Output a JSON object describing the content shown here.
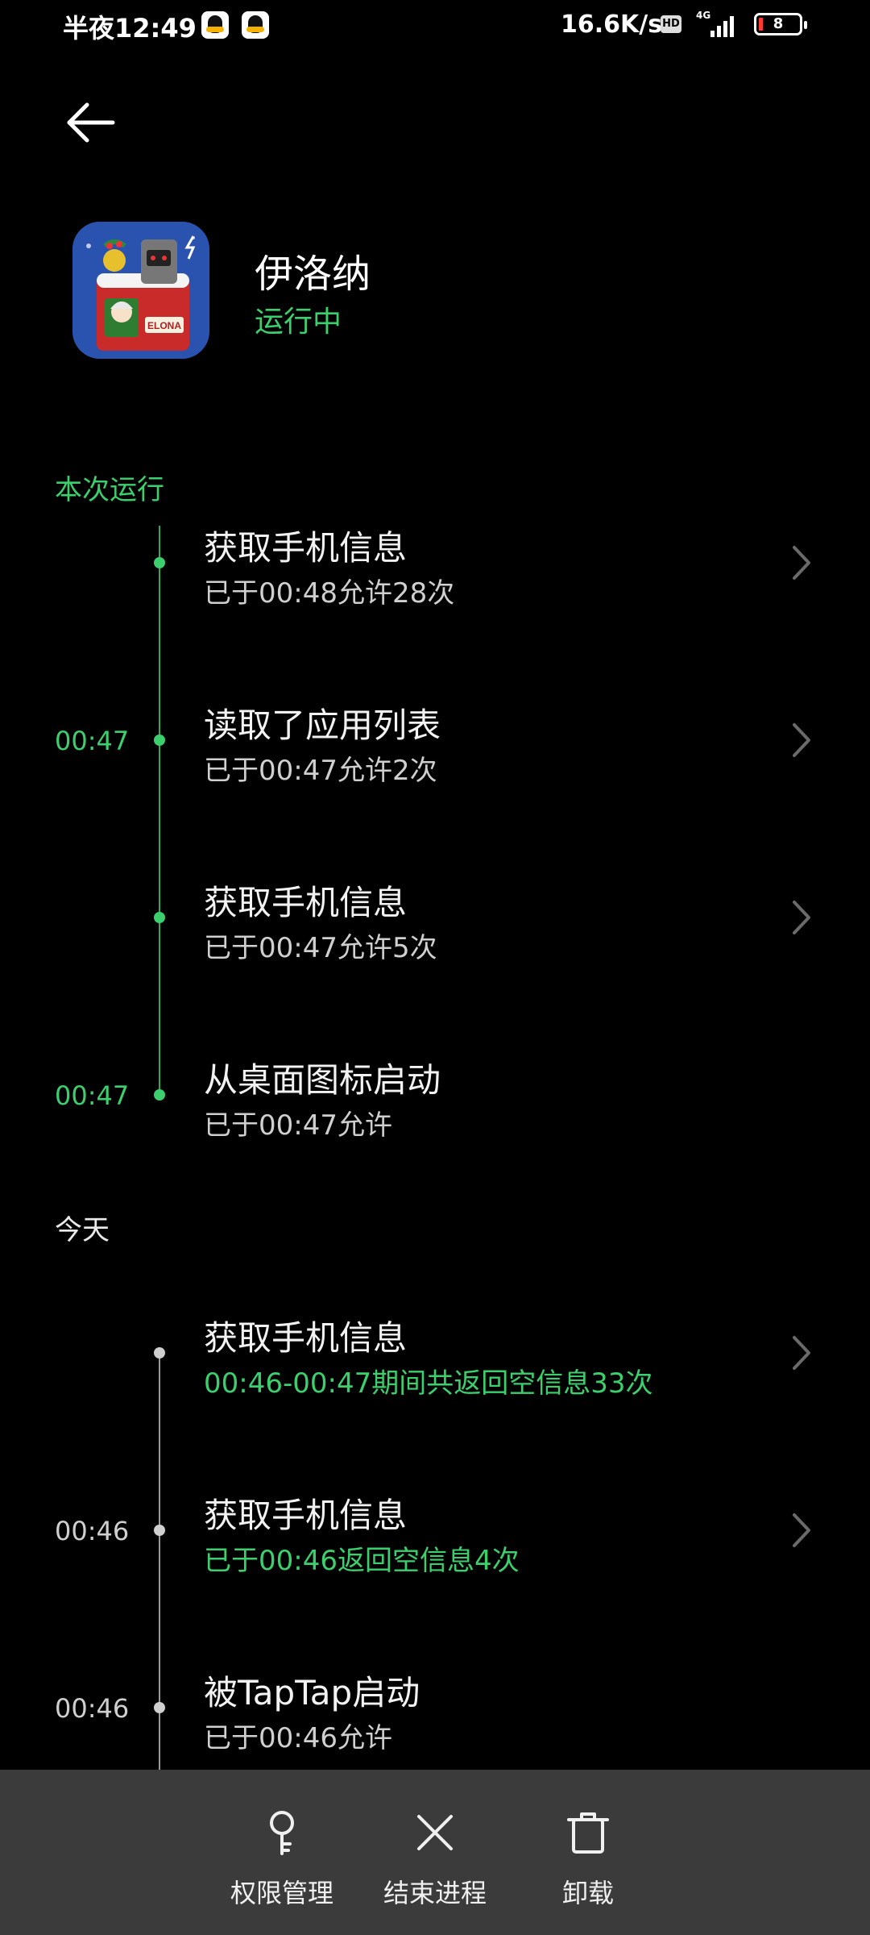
{
  "status_bar": {
    "time": "半夜12:49",
    "speed": "16.6K/s",
    "hd": "HD",
    "network": "4G",
    "battery": "8"
  },
  "app": {
    "name": "伊洛纳",
    "status": "运行中",
    "icon_text": "ELONA"
  },
  "sections": {
    "current_run": "本次运行",
    "today": "今天"
  },
  "current_entries": [
    {
      "time": "",
      "title": "获取手机信息",
      "detail": "已于00:48允许28次"
    },
    {
      "time": "00:47",
      "title": "读取了应用列表",
      "detail": "已于00:47允许2次"
    },
    {
      "time": "",
      "title": "获取手机信息",
      "detail": "已于00:47允许5次"
    },
    {
      "time": "00:47",
      "title": "从桌面图标启动",
      "detail": "已于00:47允许"
    }
  ],
  "today_entries": [
    {
      "time": "",
      "title": "获取手机信息",
      "detail": "00:46-00:47期间共返回空信息33次"
    },
    {
      "time": "00:46",
      "title": "获取手机信息",
      "detail": "已于00:46返回空信息4次"
    },
    {
      "time": "00:46",
      "title": "被TapTap启动",
      "detail": "已于00:46允许"
    }
  ],
  "bottom_bar": {
    "permissions": "权限管理",
    "end_process": "结束进程",
    "uninstall": "卸载"
  },
  "colors": {
    "accent": "#3ccf6e",
    "background": "#000000",
    "bottom_bar": "#3b3b3b"
  }
}
